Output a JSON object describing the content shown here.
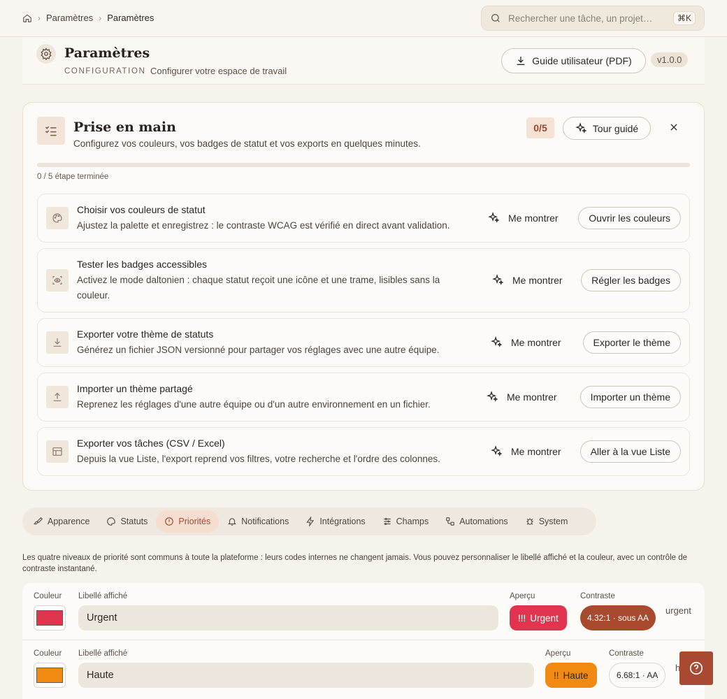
{
  "breadcrumb": {
    "home_icon": "home-icon",
    "items": [
      "Paramètres",
      "Paramètres"
    ]
  },
  "search": {
    "placeholder": "Rechercher une tâche, un projet…",
    "shortcut": "⌘K"
  },
  "header": {
    "title": "Paramètres",
    "kicker": "CONFIGURATION",
    "subtitle": "Configurer votre espace de travail",
    "pdf_button": "Guide utilisateur (PDF)",
    "version": "v1.0.0"
  },
  "onboarding": {
    "title": "Prise en main",
    "subtitle": "Configurez vos couleurs, vos badges de statut et vos exports en quelques minutes.",
    "counter": "0/5",
    "tour_button": "Tour guidé",
    "progress_fraction": 0,
    "progress_label": "0 / 5 étape terminée",
    "show_label": "Me montrer",
    "steps": [
      {
        "icon": "palette-icon",
        "title": "Choisir vos couleurs de statut",
        "desc": "Ajustez la palette et enregistrez : le contraste WCAG est vérifié en direct avant validation.",
        "button": "Ouvrir les couleurs"
      },
      {
        "icon": "scan-eye-icon",
        "title": "Tester les badges accessibles",
        "desc": "Activez le mode daltonien : chaque statut reçoit une icône et une trame, lisibles sans la couleur.",
        "button": "Régler les badges"
      },
      {
        "icon": "download-icon",
        "title": "Exporter votre thème de statuts",
        "desc": "Générez un fichier JSON versionné pour partager vos réglages avec une autre équipe.",
        "button": "Exporter le thème"
      },
      {
        "icon": "upload-icon",
        "title": "Importer un thème partagé",
        "desc": "Reprenez les réglages d'une autre équipe ou d'un autre environnement en un fichier.",
        "button": "Importer un thème"
      },
      {
        "icon": "table-icon",
        "title": "Exporter vos tâches (CSV / Excel)",
        "desc": "Depuis la vue Liste, l'export reprend vos filtres, votre recherche et l'ordre des colonnes.",
        "button": "Aller à la vue Liste"
      }
    ]
  },
  "tabs": [
    {
      "label": "Apparence",
      "icon": "brush-icon",
      "active": false
    },
    {
      "label": "Statuts",
      "icon": "palette-icon",
      "active": false
    },
    {
      "label": "Priorités",
      "icon": "alert-circle-icon",
      "active": true
    },
    {
      "label": "Notifications",
      "icon": "bell-icon",
      "active": false
    },
    {
      "label": "Intégrations",
      "icon": "zap-icon",
      "active": false
    },
    {
      "label": "Champs",
      "icon": "sliders-icon",
      "active": false
    },
    {
      "label": "Automations",
      "icon": "workflow-icon",
      "active": false
    },
    {
      "label": "System",
      "icon": "bug-icon",
      "active": false
    }
  ],
  "priorities": {
    "intro": "Les quatre niveaux de priorité sont communs à toute la plateforme : leurs codes internes ne changent jamais. Vous pouvez personnaliser le libellé affiché et la couleur, avec un contrôle de contraste instantané.",
    "labels": {
      "color": "Couleur",
      "display": "Libellé affiché",
      "preview": "Aperçu",
      "contrast": "Contraste"
    },
    "rows": [
      {
        "color": "#e1354f",
        "label": "Urgent",
        "badge_marks": "!!!",
        "badge_text": "Urgent",
        "contrast": "4.32:1 · sous AA",
        "code": "urgent"
      },
      {
        "color": "#f08a10",
        "label": "Haute",
        "badge_marks": "!!",
        "badge_text": "Haute",
        "contrast": "6.68:1 · AA",
        "code": "h"
      }
    ]
  },
  "colors": {
    "accent": "#b8552f",
    "help_button": "#a74a31",
    "contrast_warn": "#a84a2e"
  }
}
